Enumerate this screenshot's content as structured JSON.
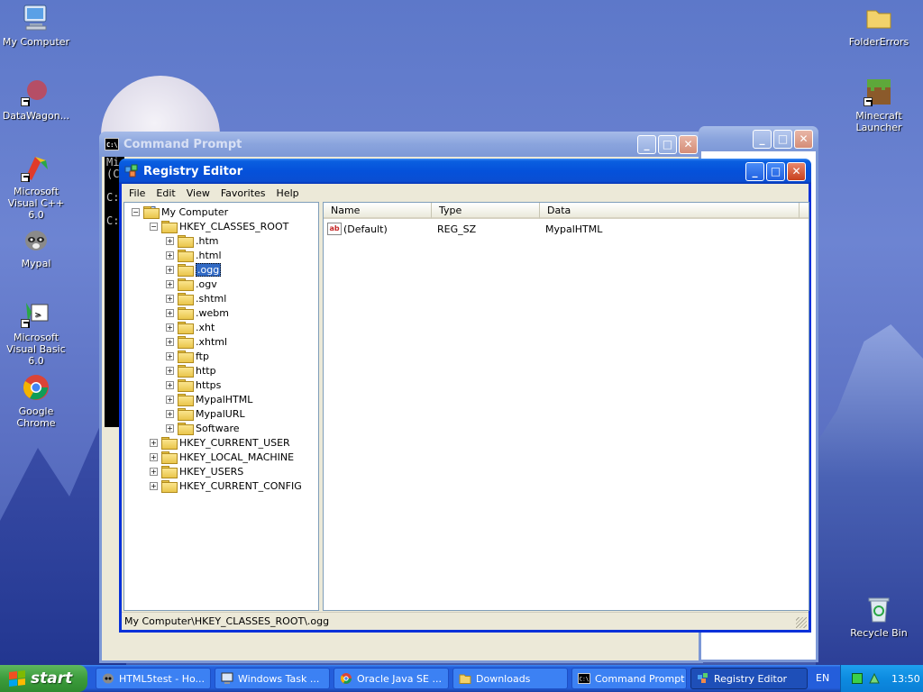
{
  "desktop": {
    "icons_left": [
      {
        "label": "My Computer"
      },
      {
        "label": "DataWagon..."
      },
      {
        "label": "Microsoft Visual C++ 6.0"
      },
      {
        "label": "Mypal"
      },
      {
        "label": "Microsoft Visual Basic 6.0"
      },
      {
        "label": "Google Chrome"
      }
    ],
    "icons_right": [
      {
        "label": "FolderErrors"
      },
      {
        "label": "Minecraft Launcher"
      },
      {
        "label": "Recycle Bin"
      }
    ]
  },
  "cmd_window": {
    "title": "Command Prompt",
    "text_lines": [
      "Mi",
      "(C",
      "",
      "C:",
      "",
      "C:"
    ]
  },
  "regedit": {
    "title": "Registry Editor",
    "menu": [
      "File",
      "Edit",
      "View",
      "Favorites",
      "Help"
    ],
    "tree": {
      "root": "My Computer",
      "hkcr": "HKEY_CLASSES_ROOT",
      "hkcr_children": [
        ".htm",
        ".html",
        ".ogg",
        ".ogv",
        ".shtml",
        ".webm",
        ".xht",
        ".xhtml",
        "ftp",
        "http",
        "https",
        "MypalHTML",
        "MypalURL",
        "Software"
      ],
      "selected": ".ogg",
      "other_hives": [
        "HKEY_CURRENT_USER",
        "HKEY_LOCAL_MACHINE",
        "HKEY_USERS",
        "HKEY_CURRENT_CONFIG"
      ]
    },
    "columns": [
      "Name",
      "Type",
      "Data"
    ],
    "values": [
      {
        "name": "(Default)",
        "type": "REG_SZ",
        "data": "MypalHTML"
      }
    ],
    "status": "My Computer\\HKEY_CLASSES_ROOT\\.ogg"
  },
  "taskbar": {
    "start_label": "start",
    "items": [
      {
        "label": "HTML5test - Ho..."
      },
      {
        "label": "Windows Task ..."
      },
      {
        "label": "Oracle Java SE ..."
      },
      {
        "label": "Downloads"
      },
      {
        "label": "Command Prompt"
      },
      {
        "label": "Registry Editor"
      }
    ],
    "language": "EN",
    "clock": "13:50"
  }
}
